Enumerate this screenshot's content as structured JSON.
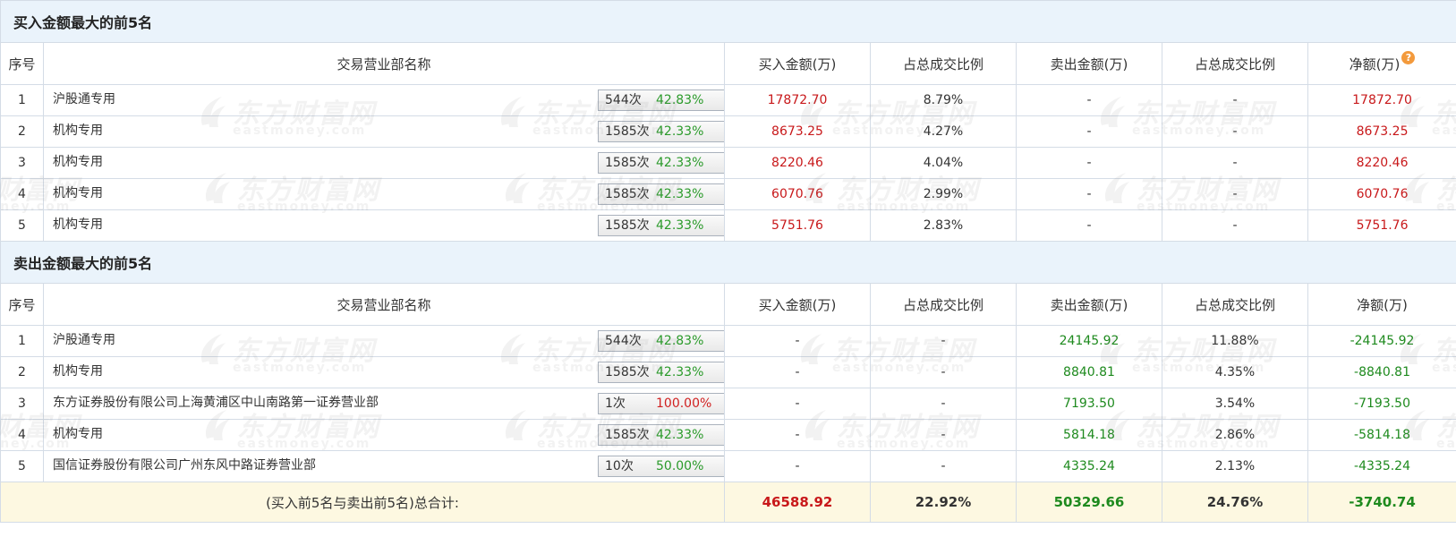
{
  "buy_section": {
    "title": "买入金额最大的前5名",
    "headers": {
      "seq": "序号",
      "name": "交易营业部名称",
      "buy": "买入金额(万)",
      "buy_pct": "占总成交比例",
      "sell": "卖出金额(万)",
      "sell_pct": "占总成交比例",
      "net": "净额(万)"
    },
    "net_help_icon": "question-icon",
    "rows": [
      {
        "seq": "1",
        "name": "沪股通专用",
        "count": "544次",
        "rate": "42.83%",
        "icon": "question-icon",
        "buy": "17872.70",
        "buy_pct": "8.79%",
        "sell": "-",
        "sell_pct": "-",
        "net": "17872.70"
      },
      {
        "seq": "2",
        "name": "机构专用",
        "count": "1585次",
        "rate": "42.33%",
        "icon": "arrow-right-icon",
        "buy": "8673.25",
        "buy_pct": "4.27%",
        "sell": "-",
        "sell_pct": "-",
        "net": "8673.25"
      },
      {
        "seq": "3",
        "name": "机构专用",
        "count": "1585次",
        "rate": "42.33%",
        "icon": "arrow-right-icon",
        "buy": "8220.46",
        "buy_pct": "4.04%",
        "sell": "-",
        "sell_pct": "-",
        "net": "8220.46"
      },
      {
        "seq": "4",
        "name": "机构专用",
        "count": "1585次",
        "rate": "42.33%",
        "icon": "arrow-right-icon",
        "buy": "6070.76",
        "buy_pct": "2.99%",
        "sell": "-",
        "sell_pct": "-",
        "net": "6070.76"
      },
      {
        "seq": "5",
        "name": "机构专用",
        "count": "1585次",
        "rate": "42.33%",
        "icon": "arrow-right-icon",
        "buy": "5751.76",
        "buy_pct": "2.83%",
        "sell": "-",
        "sell_pct": "-",
        "net": "5751.76"
      }
    ]
  },
  "sell_section": {
    "title": "卖出金额最大的前5名",
    "headers": {
      "seq": "序号",
      "name": "交易营业部名称",
      "buy": "买入金额(万)",
      "buy_pct": "占总成交比例",
      "sell": "卖出金额(万)",
      "sell_pct": "占总成交比例",
      "net": "净额(万)"
    },
    "rows": [
      {
        "seq": "1",
        "name": "沪股通专用",
        "count": "544次",
        "rate": "42.83%",
        "icon": "question-icon",
        "buy": "-",
        "buy_pct": "-",
        "sell": "24145.92",
        "sell_pct": "11.88%",
        "net": "-24145.92"
      },
      {
        "seq": "2",
        "name": "机构专用",
        "count": "1585次",
        "rate": "42.33%",
        "icon": "arrow-right-icon",
        "buy": "-",
        "buy_pct": "-",
        "sell": "8840.81",
        "sell_pct": "4.35%",
        "net": "-8840.81"
      },
      {
        "seq": "3",
        "name": "东方证券股份有限公司上海黄浦区中山南路第一证券营业部",
        "count": "1次",
        "rate": "100.00%",
        "icon": "arrow-right-icon",
        "buy": "-",
        "buy_pct": "-",
        "sell": "7193.50",
        "sell_pct": "3.54%",
        "net": "-7193.50"
      },
      {
        "seq": "4",
        "name": "机构专用",
        "count": "1585次",
        "rate": "42.33%",
        "icon": "arrow-right-icon",
        "buy": "-",
        "buy_pct": "-",
        "sell": "5814.18",
        "sell_pct": "2.86%",
        "net": "-5814.18"
      },
      {
        "seq": "5",
        "name": "国信证券股份有限公司广州东风中路证券营业部",
        "count": "10次",
        "rate": "50.00%",
        "icon": "arrow-right-icon",
        "buy": "-",
        "buy_pct": "-",
        "sell": "4335.24",
        "sell_pct": "2.13%",
        "net": "-4335.24"
      }
    ]
  },
  "total": {
    "label": "(买入前5名与卖出前5名)总合计:",
    "buy": "46588.92",
    "buy_pct": "22.92%",
    "sell": "50329.66",
    "sell_pct": "24.76%",
    "net": "-3740.74"
  },
  "watermark": {
    "cn": "东方财富网",
    "en": "eastmoney.com"
  },
  "colors": {
    "buy_red": "#c8181a",
    "sell_green": "#1e8a1e",
    "rate_green": "#2a9a2a",
    "rate_red": "#d02020",
    "header_bg": "#eaf3fb",
    "total_bg": "#fdf8e1",
    "icon_orange": "#f39a3c",
    "arrow_blue": "#2b4a7e"
  }
}
